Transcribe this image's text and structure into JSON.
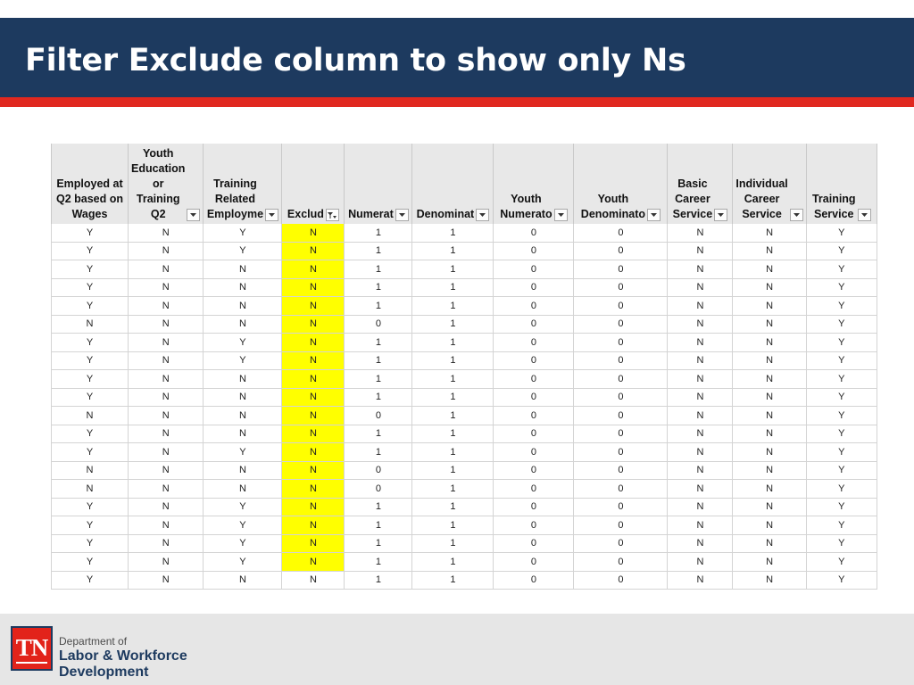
{
  "slide": {
    "title": "Filter Exclude column to show only Ns",
    "colors": {
      "title_bar": "#1d3a5f",
      "accent_line": "#e0281f",
      "highlight": "#ffff00"
    }
  },
  "sheet": {
    "columns": [
      {
        "label": "Employed at\nQ2 based on\nWages",
        "filter": false
      },
      {
        "label": "Youth\nEducation\nor Training\nQ2",
        "filter": true
      },
      {
        "label": "Training\nRelated\nEmployme",
        "filter": true
      },
      {
        "label": "Exclud",
        "filter": true,
        "filtered": true
      },
      {
        "label": "Numerat",
        "filter": true
      },
      {
        "label": "Denominat",
        "filter": true
      },
      {
        "label": "Youth\nNumerato",
        "filter": true
      },
      {
        "label": "Youth\nDenominato",
        "filter": true
      },
      {
        "label": "Basic\nCareer\nService",
        "filter": true
      },
      {
        "label": "Individual\nCareer\nService",
        "filter": true
      },
      {
        "label": "Training\nService",
        "filter": true
      }
    ],
    "highlight_column": 3,
    "highlight_rows": 19,
    "rows": [
      [
        "Y",
        "N",
        "Y",
        "N",
        "1",
        "1",
        "0",
        "0",
        "N",
        "N",
        "Y"
      ],
      [
        "Y",
        "N",
        "Y",
        "N",
        "1",
        "1",
        "0",
        "0",
        "N",
        "N",
        "Y"
      ],
      [
        "Y",
        "N",
        "N",
        "N",
        "1",
        "1",
        "0",
        "0",
        "N",
        "N",
        "Y"
      ],
      [
        "Y",
        "N",
        "N",
        "N",
        "1",
        "1",
        "0",
        "0",
        "N",
        "N",
        "Y"
      ],
      [
        "Y",
        "N",
        "N",
        "N",
        "1",
        "1",
        "0",
        "0",
        "N",
        "N",
        "Y"
      ],
      [
        "N",
        "N",
        "N",
        "N",
        "0",
        "1",
        "0",
        "0",
        "N",
        "N",
        "Y"
      ],
      [
        "Y",
        "N",
        "Y",
        "N",
        "1",
        "1",
        "0",
        "0",
        "N",
        "N",
        "Y"
      ],
      [
        "Y",
        "N",
        "Y",
        "N",
        "1",
        "1",
        "0",
        "0",
        "N",
        "N",
        "Y"
      ],
      [
        "Y",
        "N",
        "N",
        "N",
        "1",
        "1",
        "0",
        "0",
        "N",
        "N",
        "Y"
      ],
      [
        "Y",
        "N",
        "N",
        "N",
        "1",
        "1",
        "0",
        "0",
        "N",
        "N",
        "Y"
      ],
      [
        "N",
        "N",
        "N",
        "N",
        "0",
        "1",
        "0",
        "0",
        "N",
        "N",
        "Y"
      ],
      [
        "Y",
        "N",
        "N",
        "N",
        "1",
        "1",
        "0",
        "0",
        "N",
        "N",
        "Y"
      ],
      [
        "Y",
        "N",
        "Y",
        "N",
        "1",
        "1",
        "0",
        "0",
        "N",
        "N",
        "Y"
      ],
      [
        "N",
        "N",
        "N",
        "N",
        "0",
        "1",
        "0",
        "0",
        "N",
        "N",
        "Y"
      ],
      [
        "N",
        "N",
        "N",
        "N",
        "0",
        "1",
        "0",
        "0",
        "N",
        "N",
        "Y"
      ],
      [
        "Y",
        "N",
        "Y",
        "N",
        "1",
        "1",
        "0",
        "0",
        "N",
        "N",
        "Y"
      ],
      [
        "Y",
        "N",
        "Y",
        "N",
        "1",
        "1",
        "0",
        "0",
        "N",
        "N",
        "Y"
      ],
      [
        "Y",
        "N",
        "Y",
        "N",
        "1",
        "1",
        "0",
        "0",
        "N",
        "N",
        "Y"
      ],
      [
        "Y",
        "N",
        "Y",
        "N",
        "1",
        "1",
        "0",
        "0",
        "N",
        "N",
        "Y"
      ],
      [
        "Y",
        "N",
        "N",
        "N",
        "1",
        "1",
        "0",
        "0",
        "N",
        "N",
        "Y"
      ]
    ]
  },
  "footer": {
    "logo_text": "TN",
    "dept_line1": "Department of",
    "dept_line2": "Labor & Workforce\nDevelopment"
  }
}
